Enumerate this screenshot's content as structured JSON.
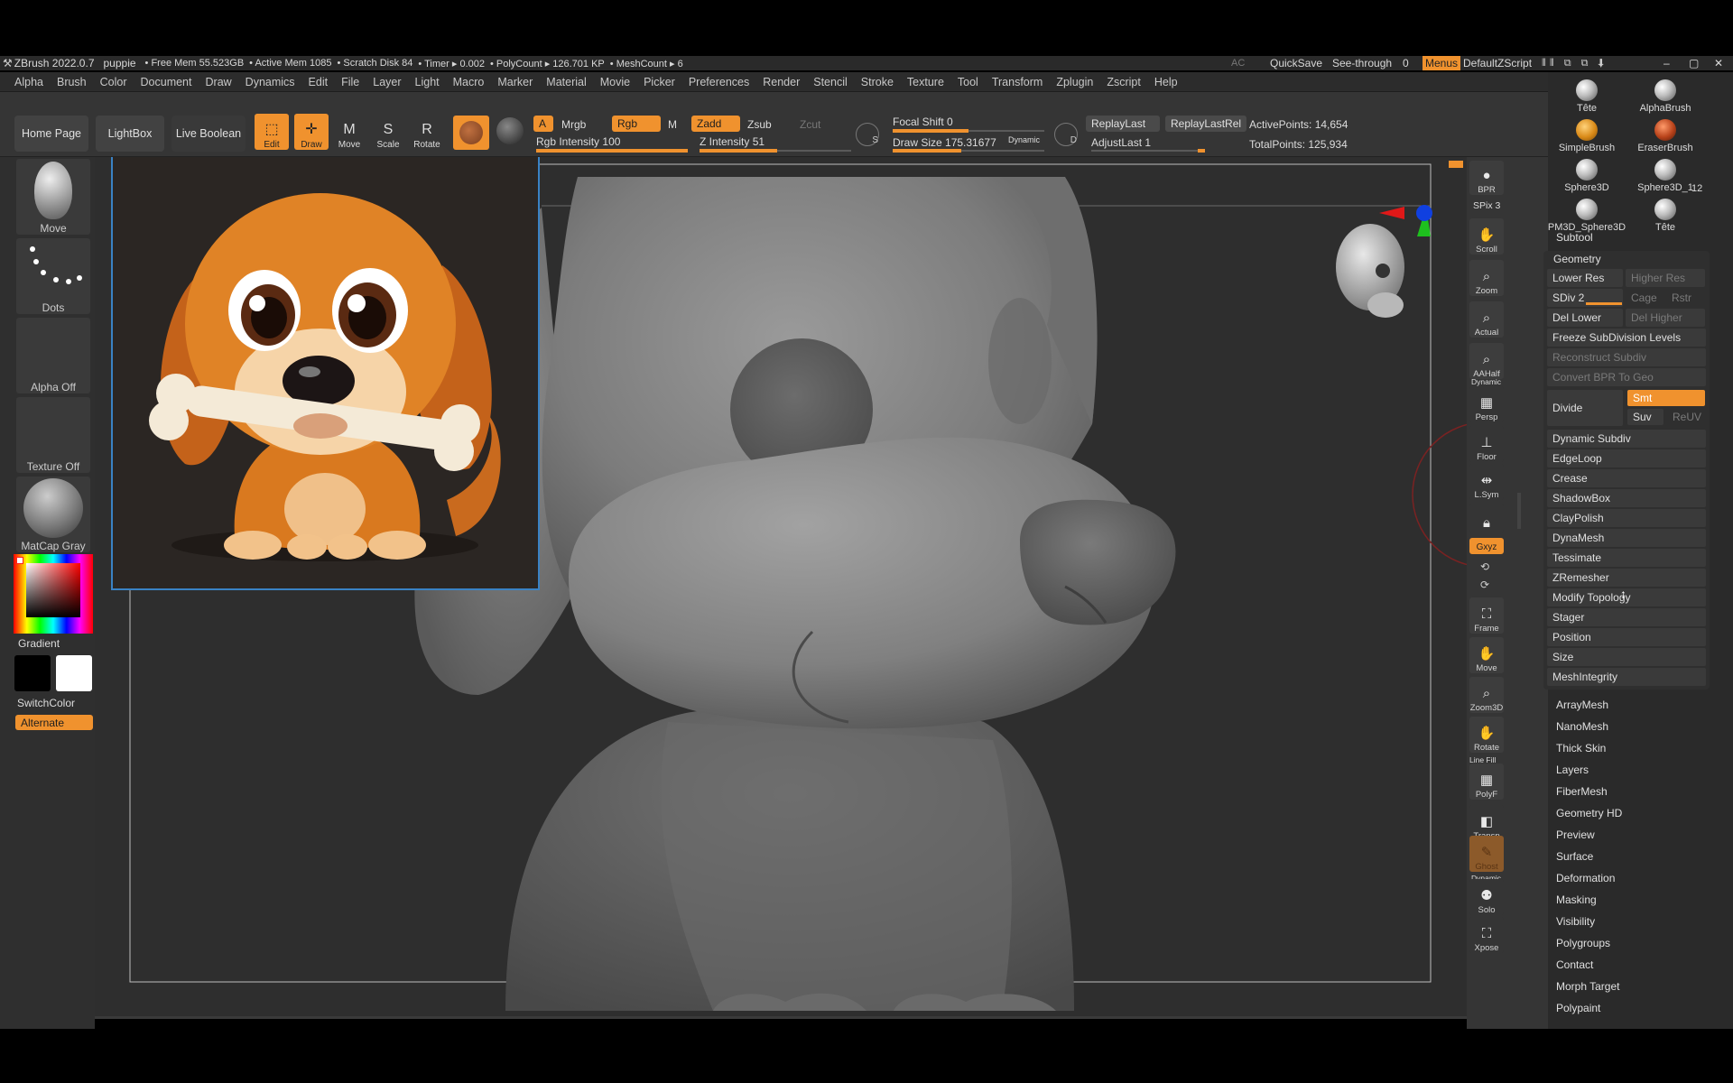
{
  "title_bar": {
    "app": "ZBrush 2022.0.7",
    "doc": "puppie",
    "free_mem": "• Free Mem 55.523GB",
    "active_mem": "• Active Mem 1085",
    "scratch": "• Scratch Disk 84",
    "timer": "• Timer ▸ 0.002",
    "polycount": "• PolyCount ▸ 126.701 KP",
    "meshcount": "• MeshCount ▸ 6",
    "ac": "AC",
    "quicksave": "QuickSave",
    "seethrough": "See-through",
    "seethrough_val": "0",
    "menus": "Menus",
    "script": "DefaultZScript"
  },
  "menus": [
    "Alpha",
    "Brush",
    "Color",
    "Document",
    "Draw",
    "Dynamics",
    "Edit",
    "File",
    "Layer",
    "Light",
    "Macro",
    "Marker",
    "Material",
    "Movie",
    "Picker",
    "Preferences",
    "Render",
    "Stencil",
    "Stroke",
    "Texture",
    "Tool",
    "Transform",
    "Zplugin",
    "Zscript",
    "Help"
  ],
  "top": {
    "home": "Home Page",
    "lightbox": "LightBox",
    "liveboolean": "Live Boolean",
    "edit": "Edit",
    "draw": "Draw",
    "move": "Move",
    "scale": "Scale",
    "rotate": "Rotate",
    "a": "A",
    "mrgb": "Mrgb",
    "rgb": "Rgb",
    "m": "M",
    "zadd": "Zadd",
    "zsub": "Zsub",
    "zcut": "Zcut",
    "rgb_intensity": "Rgb Intensity",
    "rgb_intensity_val": "100",
    "z_intensity": "Z Intensity",
    "z_intensity_val": "51",
    "focal_shift": "Focal Shift",
    "focal_shift_val": "0",
    "draw_size": "Draw Size",
    "draw_size_val": "175.31677",
    "dynamic": "Dynamic",
    "replaylast": "ReplayLast",
    "replaylastrel": "ReplayLastRel",
    "adjustlast": "AdjustLast",
    "adjustlast_val": "1",
    "active_points": "ActivePoints: 14,654",
    "total_points": "TotalPoints: 125,934",
    "s_label": "S",
    "d_label": "D",
    "fill_focal": 0.5,
    "fill_rgb": 1.0,
    "fill_z": 0.51,
    "fill_draw": 0.45
  },
  "left": {
    "move": "Move",
    "dots": "Dots",
    "alpha": "Alpha Off",
    "texture": "Texture Off",
    "matcap": "MatCap Gray",
    "gradient": "Gradient",
    "switchcolor": "SwitchColor",
    "alternate": "Alternate"
  },
  "right": {
    "bpr": "BPR",
    "spix": "SPix 3",
    "scroll": "Scroll",
    "zoom": "Zoom",
    "actual": "Actual",
    "aahalf": "AAHalf",
    "dynamic": "Dynamic",
    "persp": "Persp",
    "floor": "Floor",
    "lsym": "L.Sym",
    "xyz": "Gxyz",
    "frame": "Frame",
    "move": "Move",
    "zoom3d": "Zoom3D",
    "rotate": "Rotate",
    "linefill": "Line Fill",
    "polyf": "PolyF",
    "transp": "Transp",
    "ghost": "Ghost",
    "dynamic2": "Dynamic",
    "solo": "Solo",
    "xpose": "Xpose"
  },
  "tool_thumbs": [
    "Tête",
    "AlphaBrush",
    "SimpleBrush",
    "EraserBrush",
    "Sphere3D",
    "Sphere3D_1",
    "PM3D_Sphere3D",
    "Tête"
  ],
  "thumb_count": "12",
  "tray": {
    "subtool": "Subtool",
    "geometry": "Geometry",
    "lower_res": "Lower Res",
    "higher_res": "Higher Res",
    "sdiv": "SDiv 2",
    "cage": "Cage",
    "rstr": "Rstr",
    "del_lower": "Del Lower",
    "del_higher": "Del Higher",
    "freeze": "Freeze SubDivision Levels",
    "reconstruct": "Reconstruct Subdiv",
    "convert_bpr": "Convert BPR To Geo",
    "divide": "Divide",
    "smt": "Smt",
    "suv": "Suv",
    "reuv": "ReUV",
    "geo_items": [
      "Dynamic Subdiv",
      "EdgeLoop",
      "Crease",
      "ShadowBox",
      "ClayPolish",
      "DynaMesh",
      "Tessimate",
      "ZRemesher",
      "Modify Topology",
      "Stager",
      "Position",
      "Size",
      "MeshIntegrity"
    ],
    "sections": [
      "ArrayMesh",
      "NanoMesh",
      "Thick Skin",
      "Layers",
      "FiberMesh",
      "Geometry HD",
      "Preview",
      "Surface",
      "Deformation",
      "Masking",
      "Visibility",
      "Polygroups",
      "Contact",
      "Morph Target",
      "Polypaint"
    ]
  },
  "colors": {
    "accent": "#f0922e",
    "panel": "#353535",
    "ref_border": "#3a82c4"
  }
}
